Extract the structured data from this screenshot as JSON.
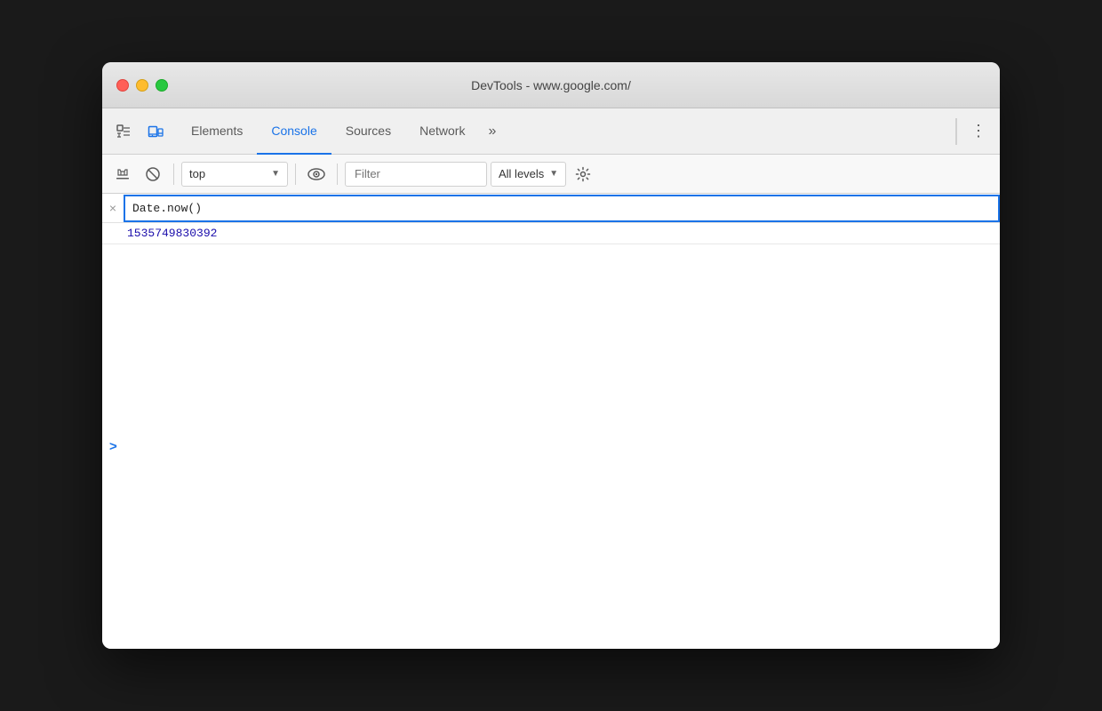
{
  "window": {
    "title": "DevTools - www.google.com/"
  },
  "titlebar": {
    "close_label": "",
    "minimize_label": "",
    "maximize_label": ""
  },
  "tabs": {
    "items": [
      {
        "id": "elements",
        "label": "Elements",
        "active": false
      },
      {
        "id": "console",
        "label": "Console",
        "active": true
      },
      {
        "id": "sources",
        "label": "Sources",
        "active": false
      },
      {
        "id": "network",
        "label": "Network",
        "active": false
      }
    ],
    "more_label": "»"
  },
  "toolbar": {
    "context_value": "top",
    "filter_placeholder": "Filter",
    "levels_label": "All levels"
  },
  "console": {
    "input_value": "Date.now()",
    "result_value": "1535749830392",
    "cancel_icon": "×",
    "prompt_icon": ">"
  }
}
